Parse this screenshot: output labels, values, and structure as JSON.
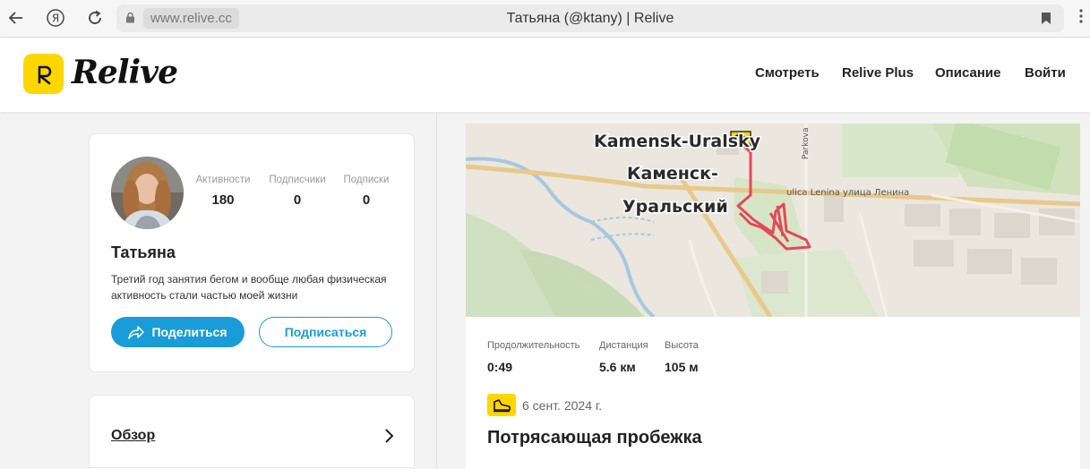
{
  "browser": {
    "url": "www.relive.cc",
    "tab_title": "Татьяна (@ktany) | Relive"
  },
  "header": {
    "logo_text": "Relive",
    "nav": [
      "Смотреть",
      "Relive Plus",
      "Описание",
      "Войти"
    ]
  },
  "profile": {
    "stats": [
      {
        "label": "Активности",
        "value": "180"
      },
      {
        "label": "Подписчики",
        "value": "0"
      },
      {
        "label": "Подписки",
        "value": "0"
      }
    ],
    "name": "Татьяна",
    "bio": "Третий год занятия бегом и вообще любая физическая активность стали частью моей жизни",
    "share_label": "Поделиться",
    "follow_label": "Подписаться"
  },
  "overview": {
    "label": "Обзор"
  },
  "activity": {
    "map_labels": {
      "city_latin": "Kamensk-Uralsky",
      "city_ru_line1": "Каменск-",
      "city_ru_line2": "Уральский",
      "street": "ulica Lenina улица Ленина",
      "street_vertical": "Parkova"
    },
    "stats": [
      {
        "label": "Продолжительность",
        "value": "0:49"
      },
      {
        "label": "Дистанция",
        "value": "5.6 км"
      },
      {
        "label": "Высота",
        "value": "105 м"
      }
    ],
    "date": "6 сент. 2024 г.",
    "title": "Потрясающая пробежка"
  },
  "colors": {
    "brand_yellow": "#ffd600",
    "share_blue": "#1a9cd8",
    "route_red": "#e5485a"
  }
}
